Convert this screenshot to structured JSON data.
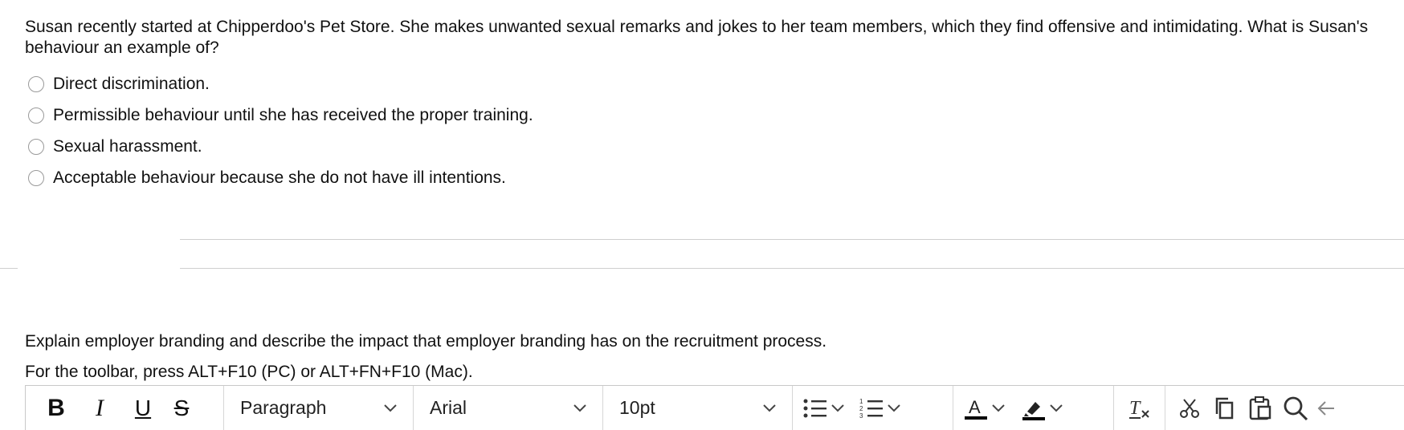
{
  "question1": {
    "text": "Susan recently started at Chipperdoo's Pet Store. She makes unwanted sexual remarks and jokes to her team members, which they find offensive and intimidating. What is Susan's behaviour an example of?",
    "options": [
      "Direct discrimination.",
      "Permissible behaviour until she has received the proper training.",
      "Sexual harassment.",
      "Acceptable behaviour because she do not have ill intentions."
    ]
  },
  "question2": {
    "text": "Explain employer branding and describe the impact that employer branding has on the recruitment process."
  },
  "editor": {
    "toolbar_hint": "For the toolbar, press ALT+F10 (PC) or ALT+FN+F10 (Mac).",
    "block_format": "Paragraph",
    "font_family": "Arial",
    "font_size": "10pt",
    "icons": {
      "bold": "bold-icon",
      "italic": "italic-icon",
      "underline": "underline-icon",
      "strikethrough": "strikethrough-icon",
      "bullet_list": "bullet-list-icon",
      "numbered_list": "numbered-list-icon",
      "text_color": "text-color-icon",
      "highlight": "highlight-icon",
      "clear_format": "clear-formatting-icon",
      "cut": "cut-icon",
      "copy": "copy-icon",
      "paste": "paste-icon",
      "find": "search-icon",
      "more": "arrow-left-icon"
    }
  }
}
